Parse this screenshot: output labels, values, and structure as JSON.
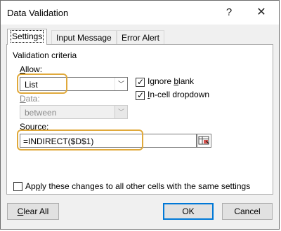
{
  "window": {
    "title": "Data Validation",
    "help_glyph": "?",
    "close_glyph": "✕"
  },
  "tabs": [
    {
      "label": "Settings",
      "active": true
    },
    {
      "label": "Input Message",
      "active": false
    },
    {
      "label": "Error Alert",
      "active": false
    }
  ],
  "settings": {
    "group_title": "Validation criteria",
    "allow": {
      "label_pre": "",
      "label_key": "A",
      "label_post": "llow:",
      "value": "List"
    },
    "ignore_blank": {
      "label_pre": "Ignore ",
      "label_key": "b",
      "label_post": "lank",
      "checked": true
    },
    "in_cell_dropdown": {
      "label_pre": "",
      "label_key": "I",
      "label_post": "n-cell dropdown",
      "checked": true
    },
    "data": {
      "label_pre": "",
      "label_key": "D",
      "label_post": "ata:",
      "value": "between"
    },
    "source": {
      "label_pre": "",
      "label_key": "S",
      "label_post": "ource:",
      "value": "=INDIRECT($D$1)"
    },
    "apply_all": {
      "label_pre": "Ap",
      "label_key": "p",
      "label_post": "ly these changes to all other cells with the same settings",
      "checked": false
    }
  },
  "buttons": {
    "clear_all": {
      "label_pre": "",
      "label_key": "C",
      "label_post": "lear All"
    },
    "ok": "OK",
    "cancel": "Cancel"
  },
  "colors": {
    "highlight": "#e0a93b",
    "default_button_border": "#0078d7"
  },
  "icons": {
    "dropdown_arrow": "﹀",
    "checkmark": "✓"
  }
}
